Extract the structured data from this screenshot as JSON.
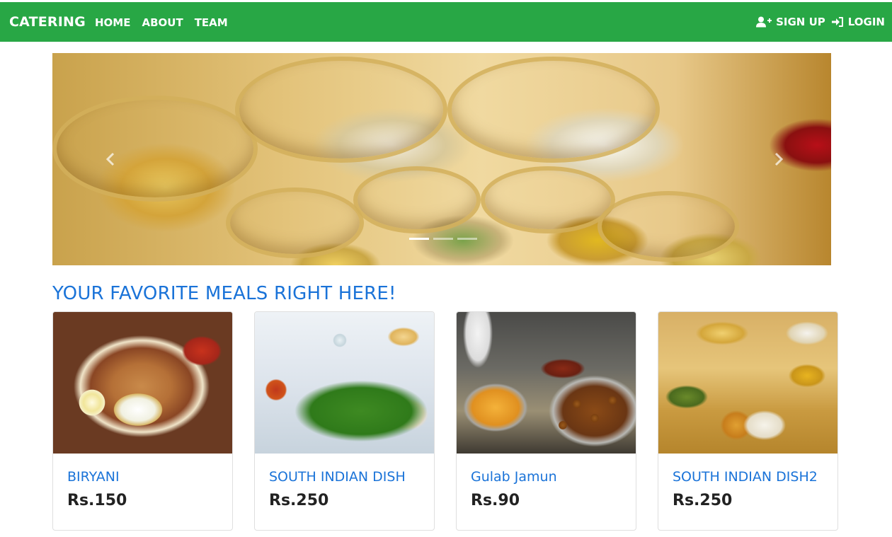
{
  "navbar": {
    "brand": "CATERING",
    "links": [
      "HOME",
      "ABOUT",
      "TEAM"
    ],
    "signup_label": "SIGN UP",
    "login_label": "LOGIN",
    "background_color": "#28a745"
  },
  "carousel": {
    "indicator_count": 3,
    "active_indicator": 1
  },
  "section": {
    "title": "YOUR FAVORITE MEALS RIGHT HERE!",
    "title_color": "#1a73d8"
  },
  "cards": [
    {
      "title": "BIRYANI",
      "price": "Rs.150"
    },
    {
      "title": "SOUTH INDIAN DISH",
      "price": "Rs.250"
    },
    {
      "title": "Gulab Jamun",
      "price": "Rs.90"
    },
    {
      "title": "SOUTH INDIAN DISH2",
      "price": "Rs.250"
    }
  ]
}
